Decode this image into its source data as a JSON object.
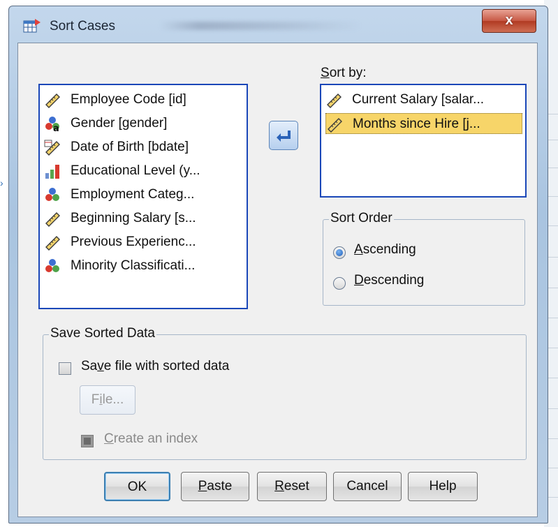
{
  "window": {
    "title": "Sort Cases",
    "close_label": "x"
  },
  "variables_list": [
    {
      "label": "Employee Code [id]",
      "icon": "scale-ruler-icon"
    },
    {
      "label": "Gender [gender]",
      "icon": "nominal-string-icon"
    },
    {
      "label": "Date of Birth [bdate]",
      "icon": "date-scale-icon"
    },
    {
      "label": "Educational Level (y...",
      "icon": "ordinal-bars-icon"
    },
    {
      "label": "Employment Categ...",
      "icon": "nominal-icon"
    },
    {
      "label": "Beginning Salary [s...",
      "icon": "scale-ruler-icon"
    },
    {
      "label": "Previous Experienc...",
      "icon": "scale-ruler-icon"
    },
    {
      "label": "Minority Classificati...",
      "icon": "nominal-icon"
    }
  ],
  "sort_by": {
    "label_prefix": "",
    "label_key": "S",
    "label_rest": "ort by:",
    "items": [
      {
        "label": "Current Salary [salar...",
        "icon": "scale-ruler-icon",
        "selected": false
      },
      {
        "label": "Months since Hire [j...",
        "icon": "scale-ruler-icon",
        "selected": true
      }
    ]
  },
  "sort_order": {
    "title": "Sort Order",
    "ascending": {
      "key": "A",
      "rest": "scending",
      "checked": true
    },
    "descending": {
      "key": "D",
      "rest": "escending",
      "checked": false
    }
  },
  "save_sorted": {
    "title": "Save Sorted Data",
    "save_file": {
      "pre": "Sa",
      "key": "v",
      "post": "e file with sorted data",
      "checked": false
    },
    "file_button": {
      "pre": "F",
      "key": "i",
      "post": "le..."
    },
    "create_index": {
      "key": "C",
      "rest": "reate an index",
      "enabled": false
    }
  },
  "buttons": {
    "ok": "OK",
    "paste": {
      "key": "P",
      "rest": "aste"
    },
    "reset": {
      "key": "R",
      "rest": "eset"
    },
    "cancel": "Cancel",
    "help": "Help"
  },
  "colors": {
    "selection": "#f7d569",
    "list_border": "#1a47b8",
    "frame": "#b7cde4"
  }
}
